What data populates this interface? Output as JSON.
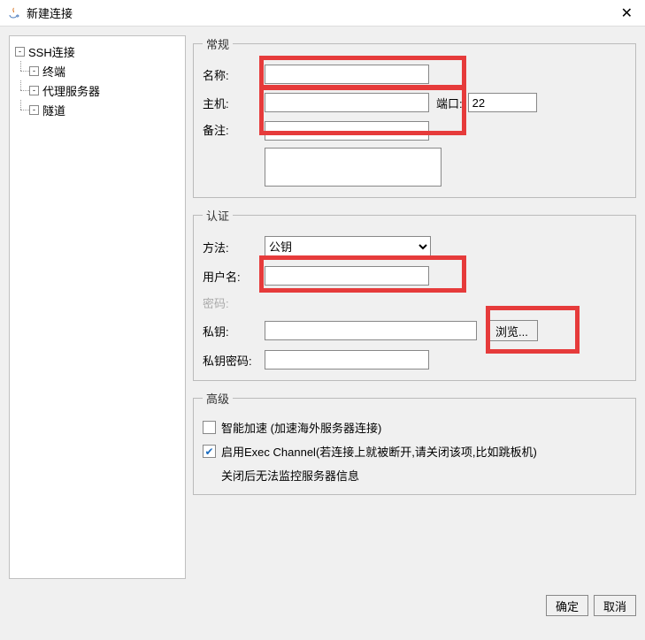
{
  "window": {
    "title": "新建连接"
  },
  "sidebar": {
    "root": {
      "label": "SSH连接",
      "toggle": "-"
    },
    "items": [
      {
        "label": "终端"
      },
      {
        "label": "代理服务器"
      },
      {
        "label": "隧道"
      }
    ]
  },
  "general": {
    "legend": "常规",
    "name_label": "名称:",
    "host_label": "主机:",
    "port_label": "端口:",
    "port_value": "22",
    "remark_label": "备注:"
  },
  "auth": {
    "legend": "认证",
    "method_label": "方法:",
    "method_value": "公钥",
    "username_label": "用户名:",
    "password_label": "密码:",
    "privkey_label": "私钥:",
    "browse_label": "浏览...",
    "passphrase_label": "私钥密码:"
  },
  "advanced": {
    "legend": "高级",
    "accel_label": "智能加速 (加速海外服务器连接)",
    "exec_label": "启用Exec Channel(若连接上就被断开,请关闭该项,比如跳板机)",
    "exec_note": "关闭后无法监控服务器信息"
  },
  "footer": {
    "ok_label": "确定",
    "cancel_label": "取消"
  }
}
